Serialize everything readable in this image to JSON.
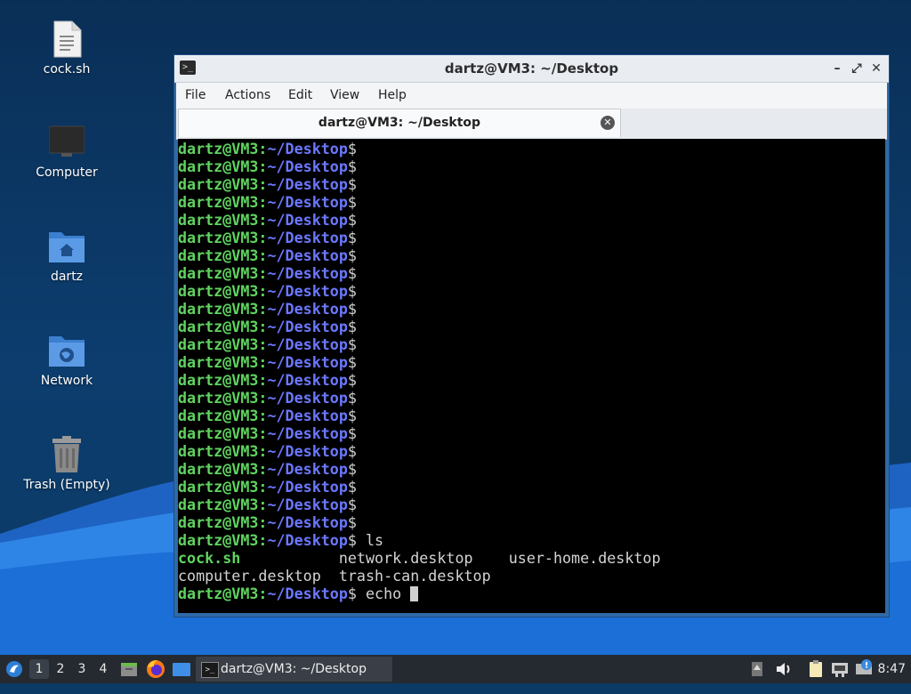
{
  "desktop": {
    "icons": [
      {
        "label": "cock.sh",
        "icon": "text-file-icon"
      },
      {
        "label": "Computer",
        "icon": "monitor-icon"
      },
      {
        "label": "dartz",
        "icon": "home-folder-icon"
      },
      {
        "label": "Network",
        "icon": "network-folder-icon"
      },
      {
        "label": "Trash (Empty)",
        "icon": "trash-icon"
      }
    ]
  },
  "window": {
    "title": "dartz@VM3: ~/Desktop",
    "controls": {
      "minimize": "–",
      "maximize": "⤢",
      "close": "✕"
    },
    "menu": [
      "File",
      "Actions",
      "Edit",
      "View",
      "Help"
    ],
    "tab": {
      "label": "dartz@VM3: ~/Desktop"
    }
  },
  "terminal": {
    "prompt_user": "dartz@VM3:",
    "prompt_path": "~/Desktop",
    "prompt_symbol": "$",
    "empty_prompt_count": 22,
    "command_ls": " ls",
    "ls_output": {
      "row1": [
        "cock.sh",
        "network.desktop",
        "user-home.desktop"
      ],
      "row2": [
        "computer.desktop",
        "trash-can.desktop"
      ]
    },
    "current_command": " echo "
  },
  "taskbar": {
    "workspaces": [
      "1",
      "2",
      "3",
      "4"
    ],
    "active_workspace": "1",
    "task_label": "dartz@VM3: ~/Desktop",
    "clock": "8:47"
  },
  "colors": {
    "prompt_user": "#5fd35f",
    "prompt_path": "#6b78ff",
    "taskbar": "#252a31",
    "window_border": "#2f6aa6"
  }
}
